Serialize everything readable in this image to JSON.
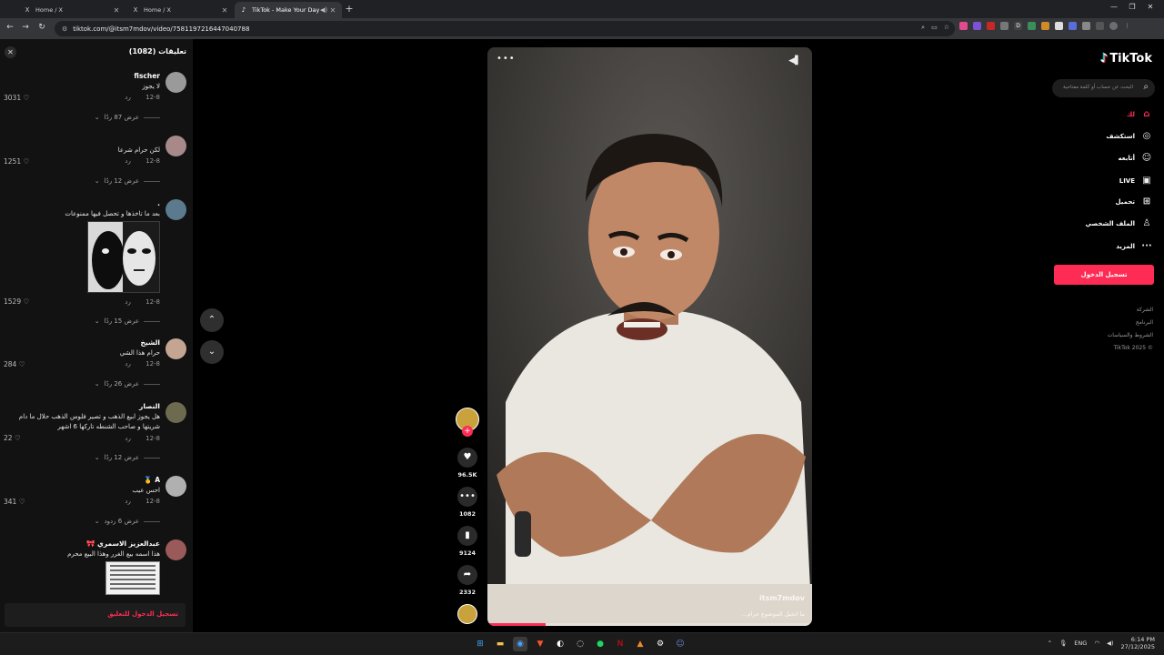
{
  "browser": {
    "tabs": [
      {
        "favicon": "X",
        "title": "Home / X",
        "active": false
      },
      {
        "favicon": "X",
        "title": "Home / X",
        "active": false
      },
      {
        "favicon": "♪",
        "title": "TikTok - Make Your Day",
        "active": true
      }
    ],
    "url": "tiktok.com/@itsm7mdov/video/7581197216447040788"
  },
  "comments_panel": {
    "header": "تعليقات (1082)",
    "reply_label": "رد",
    "items": [
      {
        "user": "fischer",
        "text": "لا يجوز",
        "date": "12-8",
        "likes": "3031",
        "replies": "عرض 87 ردًا",
        "avatar_color": "#9a9a9a"
      },
      {
        "user": "",
        "text": "لكن حرام شرعا",
        "date": "12-8",
        "likes": "1251",
        "replies": "عرض 12 ردًا",
        "avatar_color": "#a78989"
      },
      {
        "user": ".",
        "text": "بعد ما تاخذها و تحصل فيها ممنوعات",
        "date": "12-8",
        "likes": "1529",
        "replies": "عرض 15 ردًا",
        "avatar_color": "#5c7a8d"
      },
      {
        "user": "الشيخ",
        "text": "حرام هذا الشي",
        "date": "12-8",
        "likes": "284",
        "replies": "عرض 26 ردًا",
        "avatar_color": "#c4a592"
      },
      {
        "user": "النصار",
        "text_lines": [
          "هل يجوز ابيع الذهب و تصير فلوس الذهب حلال ما دام",
          "شريتها و صاحب الشنطه تاركها 6 اشهر"
        ],
        "date": "12-8",
        "likes": "22",
        "replies": "عرض 12 ردًا",
        "avatar_color": "#6e6a4f"
      },
      {
        "user": "A 🥇",
        "text": "احس عيب",
        "date": "12-8",
        "likes": "341",
        "replies": "عرض 6 ردود",
        "avatar_color": "#b0b0b0"
      },
      {
        "user": "عبدالعزيز الاسمري 🎀",
        "text": "هذا اسمه بيع الغرر وهذا البيع محرم",
        "avatar_color": "#9b5a5a"
      }
    ],
    "login_prompt": "تسجيل الدخول للتعليق"
  },
  "video": {
    "watermark": "itsm7mdov",
    "caption": "ما اتخيل الموضوع حرام...",
    "progress": 0.18
  },
  "actions": {
    "likes": "96.5K",
    "comments": "1082",
    "saves": "9124",
    "shares": "2332"
  },
  "sidebar": {
    "logo": "TikTok",
    "search_placeholder": "البحث عن حساب أو كلمة مفتاحية",
    "items": [
      {
        "label": "لك",
        "icon": "home-icon",
        "active": true
      },
      {
        "label": "استكشف",
        "icon": "compass-icon",
        "active": false
      },
      {
        "label": "أتابعه",
        "icon": "follow-icon",
        "active": false
      },
      {
        "label": "LIVE",
        "icon": "live-icon",
        "active": false
      },
      {
        "label": "تحميل",
        "icon": "upload-icon",
        "active": false
      },
      {
        "label": "الملف الشخصي",
        "icon": "profile-icon",
        "active": false
      },
      {
        "label": "المزيد",
        "icon": "more-icon",
        "active": false
      }
    ],
    "login_button": "تسجيل الدخول",
    "footer": [
      "الشركة",
      "البرنامج",
      "الشروط والسياسات",
      "© 2025 TikTok"
    ]
  },
  "taskbar": {
    "lang": "ENG",
    "time": "6:14 PM",
    "date": "27/12/2025"
  },
  "colors": {
    "accent": "#fe2c55",
    "panel_bg": "#121212",
    "chrome_bg": "#202124"
  }
}
